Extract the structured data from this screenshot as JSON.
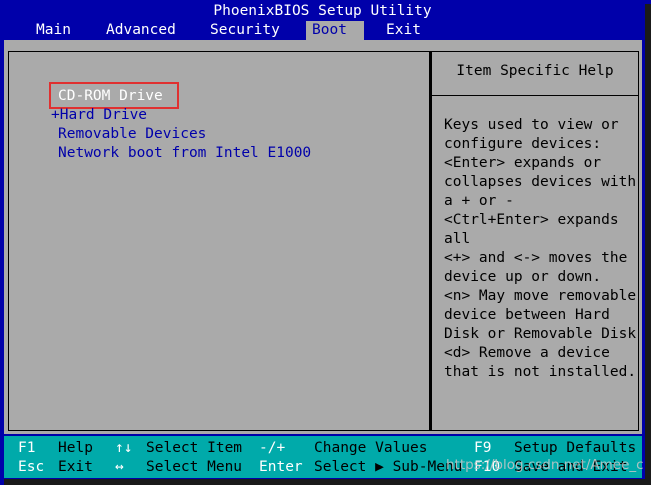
{
  "title": "PhoenixBIOS Setup Utility",
  "menu": {
    "main": "Main",
    "advanced": "Advanced",
    "security": "Security",
    "boot": "Boot",
    "exit": "Exit",
    "active": "Boot"
  },
  "boot_list": [
    "CD-ROM Drive",
    "+Hard Drive",
    "Removable Devices",
    "Network boot from Intel E1000"
  ],
  "help": {
    "title": "Item Specific Help",
    "lines": [
      "Keys used to view or",
      "configure devices:",
      "<Enter> expands or",
      "collapses devices with",
      "a + or -",
      "<Ctrl+Enter> expands",
      "all",
      "<+> and <-> moves the",
      "device up or down.",
      "<n> May move removable",
      "device between Hard",
      "Disk or Removable Disk",
      "<d> Remove a device",
      "that is not installed."
    ]
  },
  "footer": {
    "row1": {
      "k1": "F1",
      "l1": "Help",
      "k2": "↑↓",
      "l2": "Select Item",
      "k3": "-/+",
      "l3": "Change Values",
      "k4": "F9",
      "l4": "Setup Defaults"
    },
    "row2": {
      "k1": "Esc",
      "l1": "Exit",
      "k2": "↔",
      "l2": "Select Menu",
      "k3": "Enter",
      "l3": "Select ▶ Sub-Menu",
      "k4": "F10",
      "l4": "Save and Exit"
    }
  },
  "watermark": "https://blog.csdn.net/Amee_c",
  "colors": {
    "background": "#0000aa",
    "panel": "#aaaaaa",
    "footer": "#00aaaa",
    "highlight": "#e03030"
  }
}
